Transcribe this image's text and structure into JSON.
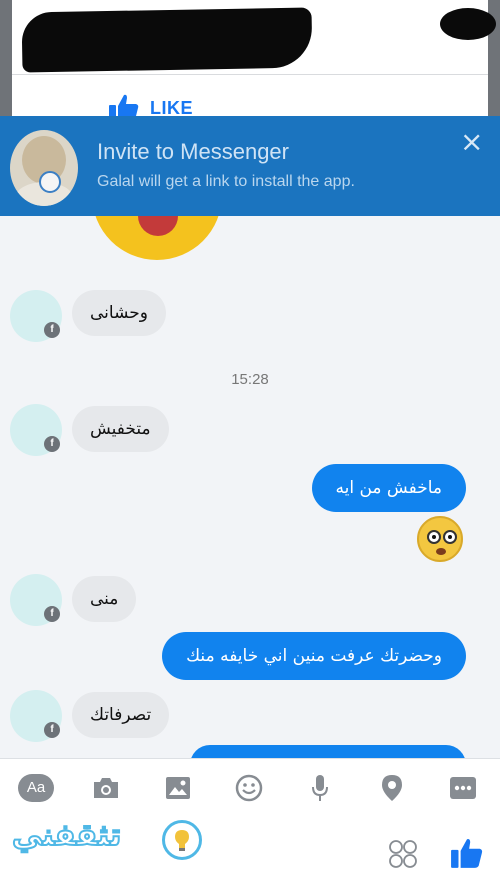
{
  "header": {
    "like_label": "LIKE"
  },
  "invite_banner": {
    "title": "Invite to Messenger",
    "subtitle": "Galal will get a link to install the app.",
    "close_glyph": "×"
  },
  "conversation": {
    "incoming": [
      {
        "text": "وحشانى"
      },
      {
        "text": "متخفيش"
      },
      {
        "text": "منى"
      },
      {
        "text": "تصرفاتك"
      }
    ],
    "timestamp": "15:28",
    "outgoing": [
      {
        "text": "ماخفش من ايه"
      },
      {
        "text": "وحضرتك عرفت منين اني خايفه منك"
      }
    ],
    "reaction_emoji": "flushed-face"
  },
  "composer": {
    "aa_label": "Aa",
    "tools": [
      "camera-icon",
      "gallery-icon",
      "emoji-icon",
      "microphone-icon",
      "location-icon",
      "more-icon"
    ],
    "accent_color": "#1877f2"
  },
  "watermark": {
    "text": "تثقفني",
    "color": "#4fb8e6"
  }
}
